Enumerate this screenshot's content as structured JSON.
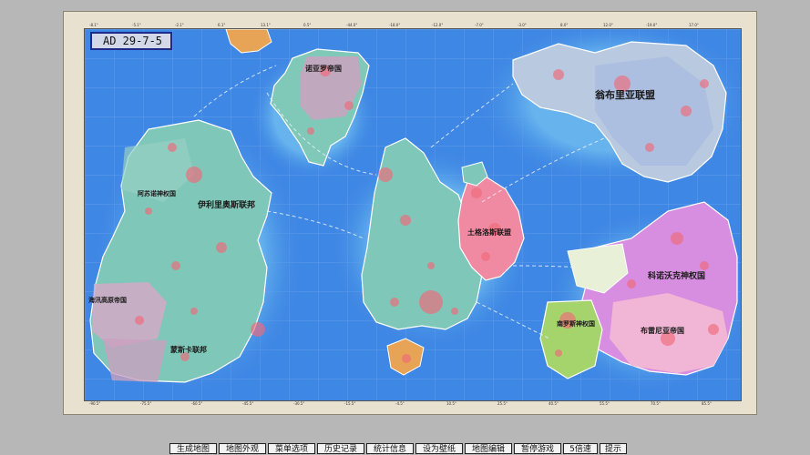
{
  "date": "AD 29-7-5",
  "nations": {
    "n1": "诺亚罗帝国",
    "n2": "翁布里亚联盟",
    "n3": "阿苏诺神权国",
    "n4": "伊利里奥斯联邦",
    "n5": "海汛高原帝国",
    "n6": "蒙斯卡联邦",
    "n7": "土格洛斯联盟",
    "n8": "科诺沃克神权国",
    "n9": "南罗斯神权国",
    "n10": "布雷尼亚帝国"
  },
  "top_ticks": [
    "-8.1°",
    "-5.1°",
    "-2.1°",
    "6.1°",
    "13.1°",
    "0.5°",
    "-44.0°",
    "-18.0°",
    "-12.0°",
    "-7.0°",
    "-3.0°",
    "8.0°",
    "12.0°",
    "-19.0°",
    "17.0°"
  ],
  "bottom_ticks": [
    "-90.5°",
    "-75.5°",
    "-60.5°",
    "-45.5°",
    "-30.5°",
    "-15.5°",
    "-4.5°",
    "10.5°",
    "25.5°",
    "40.5°",
    "55.5°",
    "70.5°",
    "85.5°"
  ],
  "toolbar": [
    "生成地图",
    "地图外观",
    "菜单选项",
    "历史记录",
    "统计信息",
    "设为壁纸",
    "地图编辑",
    "暂停游戏",
    "5倍速",
    "提示"
  ]
}
